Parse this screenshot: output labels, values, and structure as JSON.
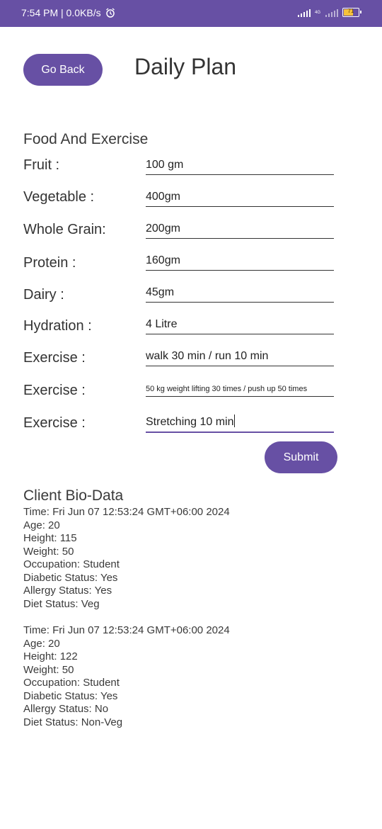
{
  "status_bar": {
    "time_net": "7:54 PM | 0.0KB/s",
    "network_type": "4G",
    "battery_level": "71"
  },
  "header": {
    "back_label": "Go Back",
    "title": "Daily Plan"
  },
  "plan": {
    "section_title": "Food And Exercise",
    "rows": [
      {
        "label": "Fruit :",
        "value": "100 gm"
      },
      {
        "label": "Vegetable :",
        "value": "400gm"
      },
      {
        "label": "Whole Grain:",
        "value": "200gm"
      },
      {
        "label": "Protein :",
        "value": "160gm"
      },
      {
        "label": "Dairy :",
        "value": "45gm"
      },
      {
        "label": "Hydration :",
        "value": "4 Litre"
      },
      {
        "label": "Exercise :",
        "value": "walk 30 min / run 10 min"
      },
      {
        "label": "Exercise :",
        "value": "50 kg weight lifting 30 times / push up 50 times"
      },
      {
        "label": "Exercise :",
        "value": "Stretching 10 min"
      }
    ],
    "submit_label": "Submit"
  },
  "bio": {
    "section_title": "Client Bio-Data",
    "records": [
      {
        "time": "Time: Fri Jun 07 12:53:24 GMT+06:00 2024",
        "age": "Age: 20",
        "height": "Height: 115",
        "weight": "Weight: 50",
        "occupation": "Occupation: Student",
        "diabetic": "Diabetic Status: Yes",
        "allergy": "Allergy Status: Yes",
        "diet": "Diet Status: Veg"
      },
      {
        "time": "Time: Fri Jun 07 12:53:24 GMT+06:00 2024",
        "age": "Age: 20",
        "height": "Height: 122",
        "weight": "Weight: 50",
        "occupation": "Occupation: Student",
        "diabetic": "Diabetic Status: Yes",
        "allergy": "Allergy Status: No",
        "diet": "Diet Status: Non-Veg"
      }
    ]
  },
  "colors": {
    "accent": "#6750a4",
    "battery": "#f5c23c"
  }
}
